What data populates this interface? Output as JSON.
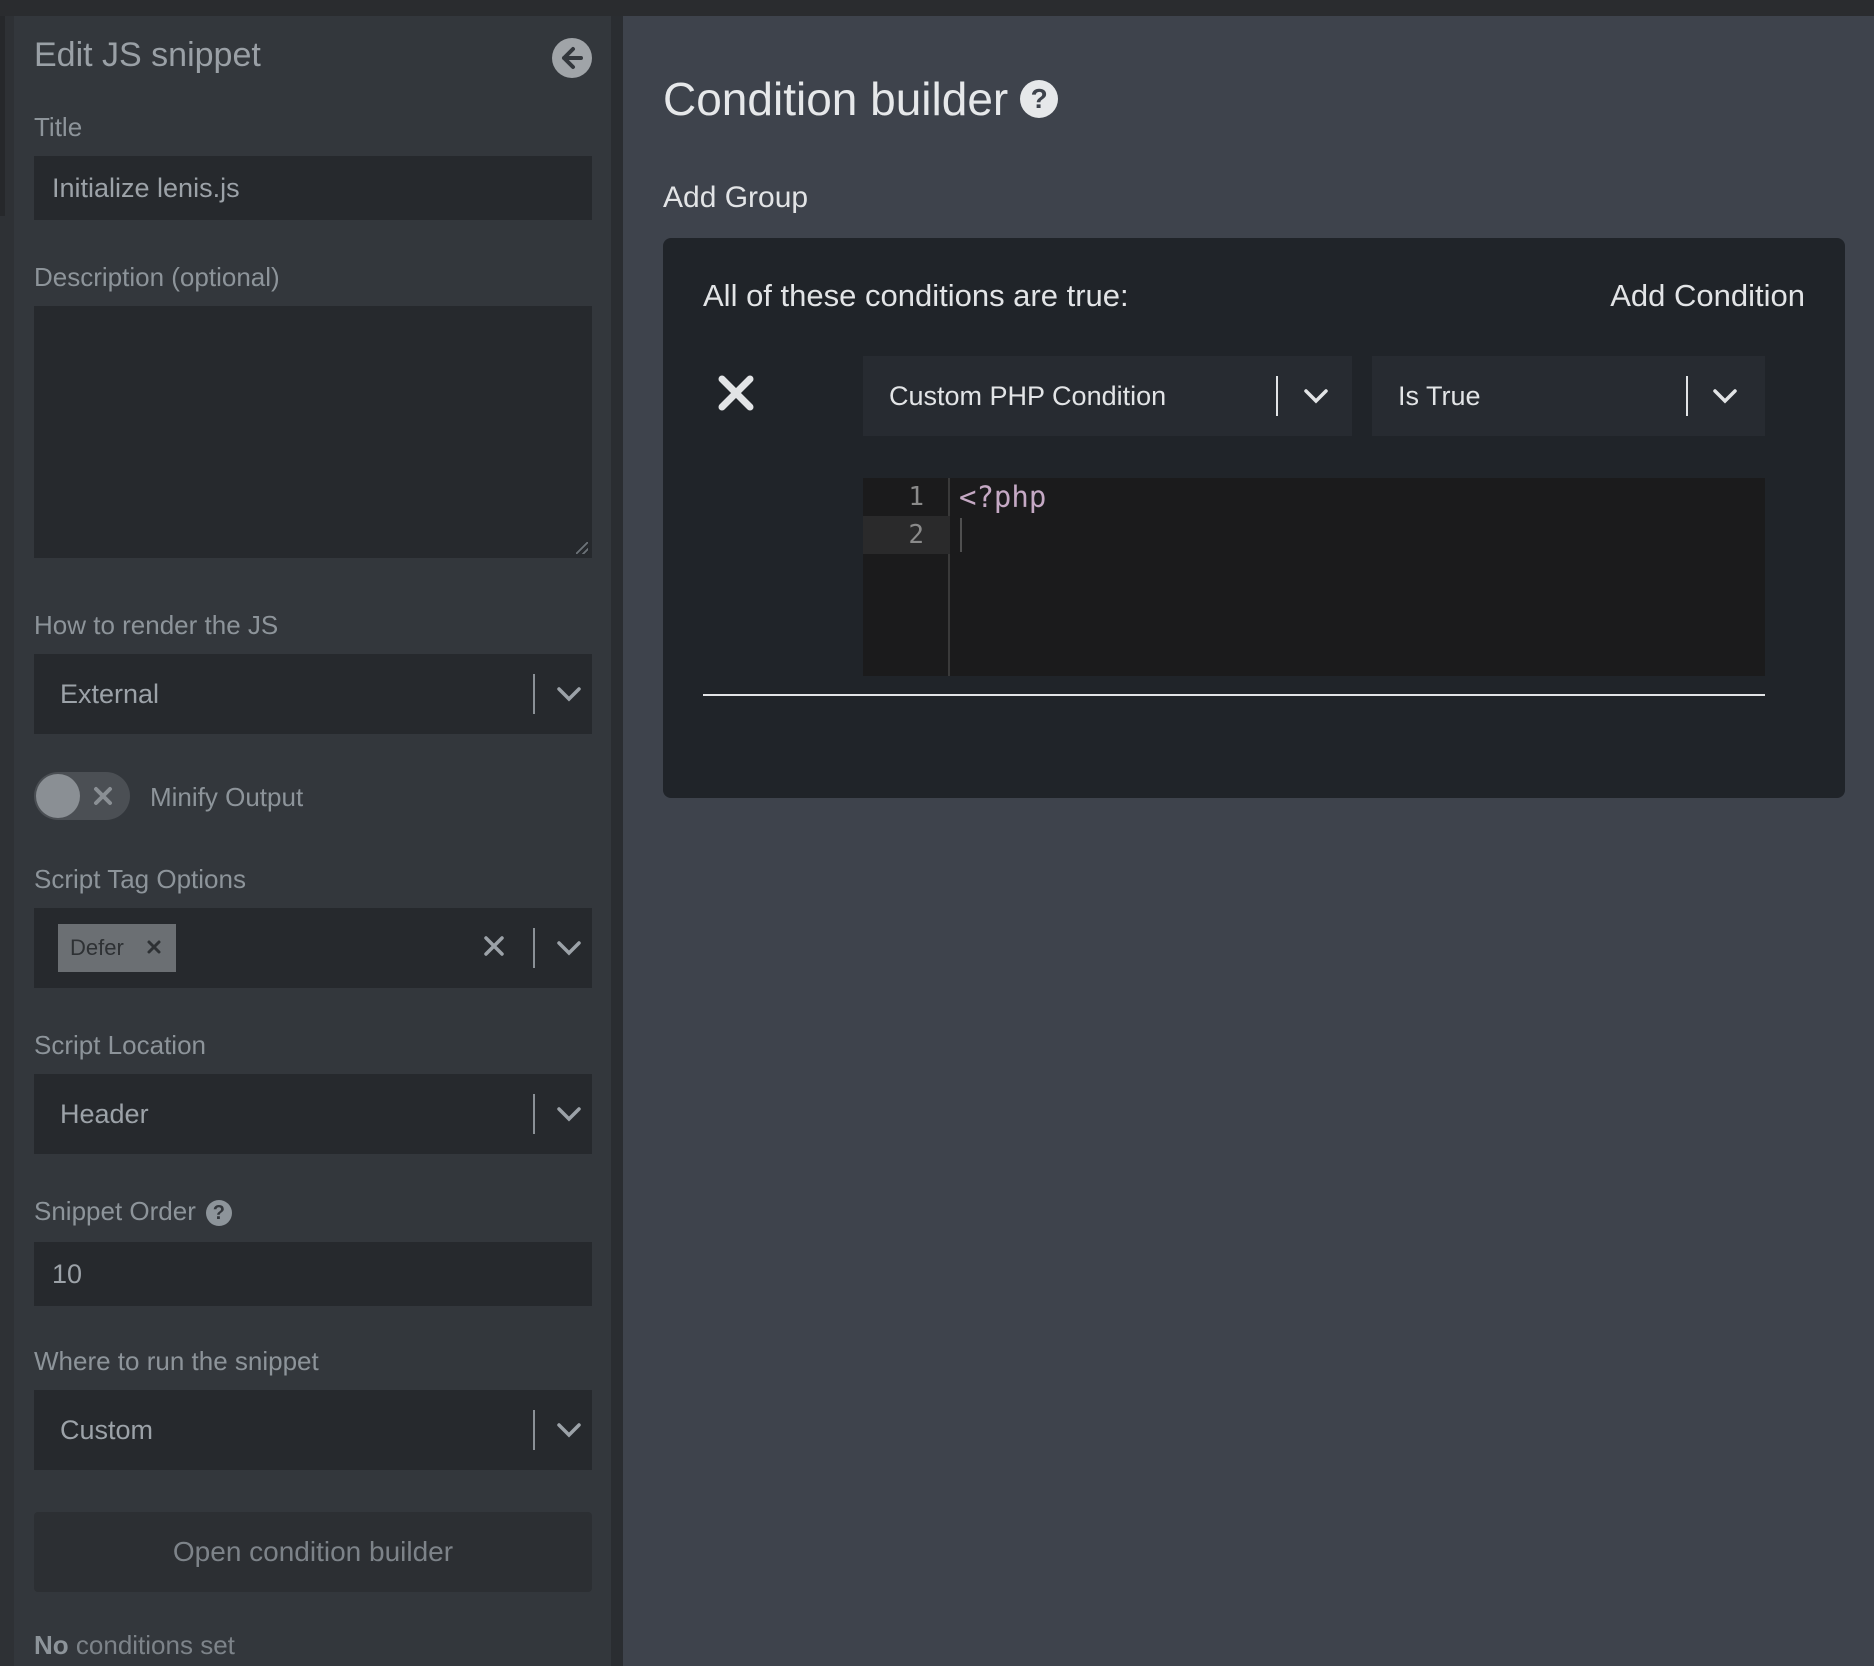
{
  "panel": {
    "title": "Edit JS snippet",
    "title_label": "Title",
    "title_value": "Initialize lenis.js",
    "description_label": "Description (optional)",
    "description_value": "",
    "render_label": "How to render the JS",
    "render_value": "External",
    "minify_label": "Minify Output",
    "minify_enabled": false,
    "script_tag_label": "Script Tag Options",
    "script_tags": [
      "Defer"
    ],
    "location_label": "Script Location",
    "location_value": "Header",
    "order_label": "Snippet Order",
    "order_value": "10",
    "where_label": "Where to run the snippet",
    "where_value": "Custom",
    "open_builder_label": "Open condition builder",
    "status_bold": "No",
    "status_rest": " conditions set"
  },
  "builder": {
    "title": "Condition builder",
    "add_group_label": "Add Group",
    "group_heading": "All of these conditions are true:",
    "add_condition_label": "Add Condition",
    "condition_type": "Custom PHP Condition",
    "condition_operator": "Is True",
    "code_lines": [
      "<?php",
      ""
    ],
    "line_numbers": [
      "1",
      "2"
    ]
  },
  "colors": {
    "panel_bg": "#33373c",
    "builder_bg": "#3e434c",
    "group_bg": "#202429",
    "php_token": "#c5a9c4"
  }
}
